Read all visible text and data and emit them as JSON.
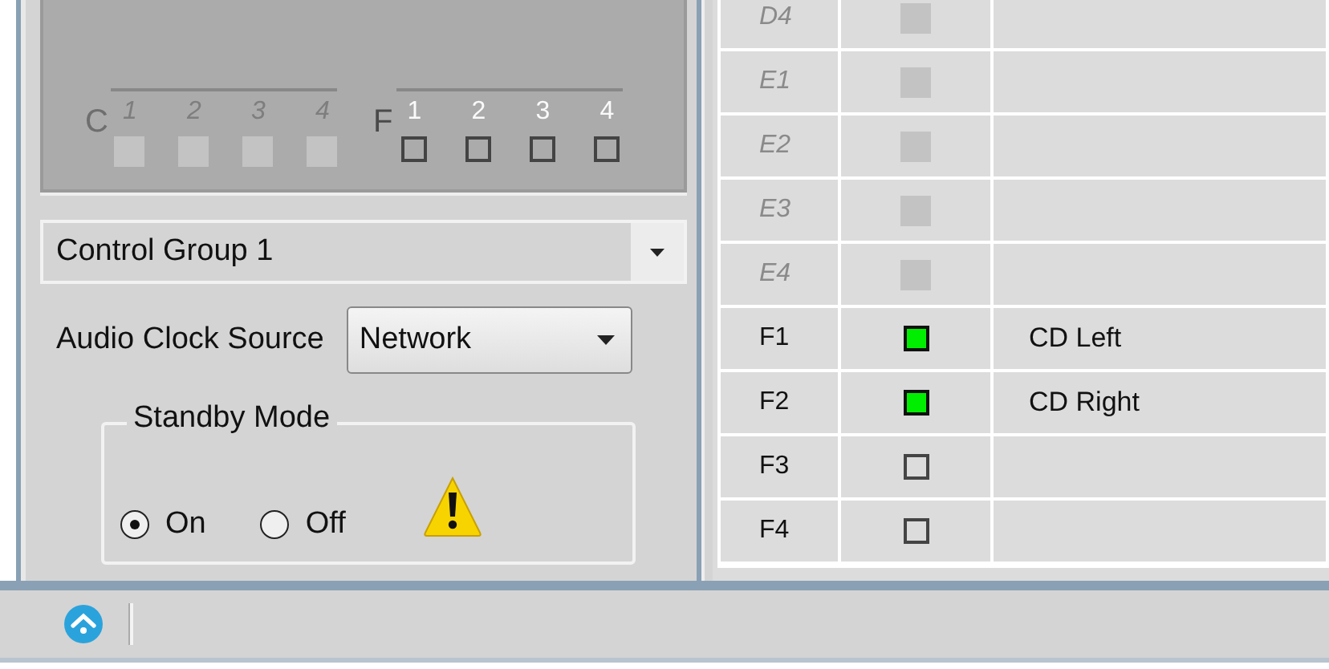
{
  "channel_groups": [
    {
      "label": "C",
      "enabled": false,
      "channels": [
        {
          "number": "1",
          "checked": false
        },
        {
          "number": "2",
          "checked": false
        },
        {
          "number": "3",
          "checked": false
        },
        {
          "number": "4",
          "checked": false
        }
      ]
    },
    {
      "label": "F",
      "enabled": true,
      "channels": [
        {
          "number": "1",
          "checked": false
        },
        {
          "number": "2",
          "checked": false
        },
        {
          "number": "3",
          "checked": false
        },
        {
          "number": "4",
          "checked": false
        }
      ]
    }
  ],
  "control_group": {
    "value": "Control Group 1"
  },
  "audio_clock_source": {
    "label": "Audio Clock Source",
    "value": "Network"
  },
  "standby_mode": {
    "title": "Standby Mode",
    "options": [
      {
        "label": "On",
        "selected": true
      },
      {
        "label": "Off",
        "selected": false
      }
    ]
  },
  "table": {
    "rows": [
      {
        "channel": "D4",
        "enabled": false,
        "checked": false
      },
      {
        "channel": "E1",
        "enabled": false,
        "checked": false
      },
      {
        "channel": "E2",
        "enabled": false,
        "checked": false
      },
      {
        "channel": "E3",
        "enabled": false,
        "checked": false
      },
      {
        "channel": "E4",
        "enabled": false,
        "checked": false
      },
      {
        "channel": "F1",
        "enabled": true,
        "checked": true,
        "name": "CD Left"
      },
      {
        "channel": "F2",
        "enabled": true,
        "checked": true,
        "name": "CD Right"
      },
      {
        "channel": "F3",
        "enabled": true,
        "checked": false
      },
      {
        "channel": "F4",
        "enabled": true,
        "checked": false
      }
    ]
  }
}
